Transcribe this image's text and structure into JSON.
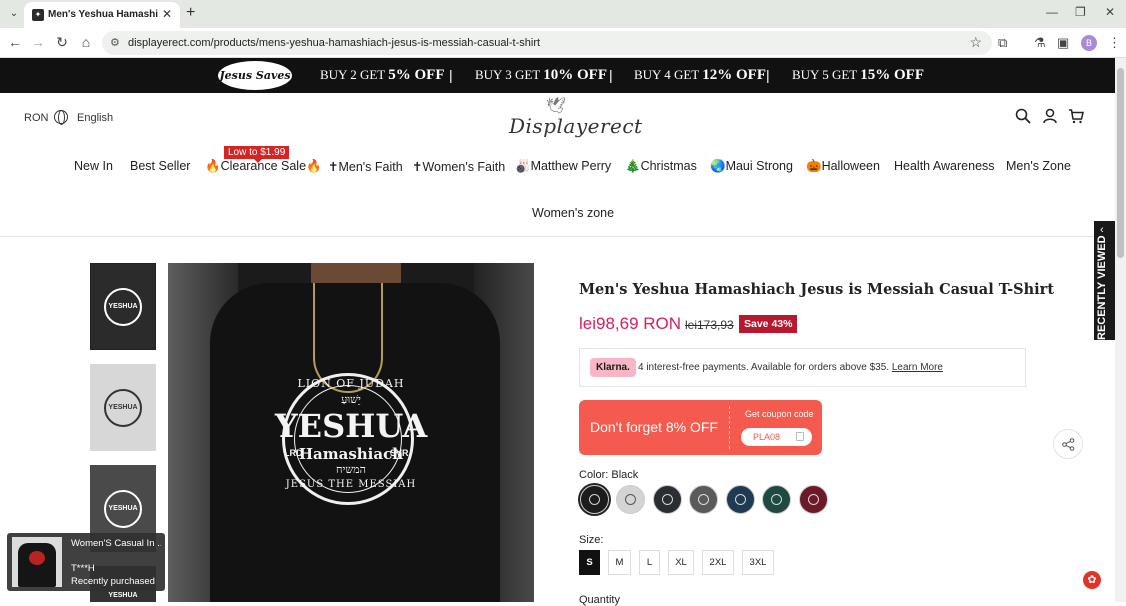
{
  "browser": {
    "tab_title": "Men's Yeshua Hamashiach Jes",
    "url": "displayerect.com/products/mens-yeshua-hamashiach-jesus-is-messiah-casual-t-shirt",
    "profile_initial": "B"
  },
  "promo": {
    "logo_text": "Jesus Saves",
    "offers": [
      {
        "buy": "BUY 2",
        "get": "GET",
        "off": "5% OFF"
      },
      {
        "buy": "BUY 3",
        "get": "GET",
        "off": "10% OFF"
      },
      {
        "buy": "BUY 4",
        "get": "GET",
        "off": "12% OFF"
      },
      {
        "buy": "BUY 5",
        "get": "GET",
        "off": "15% OFF"
      }
    ]
  },
  "header": {
    "currency": "RON",
    "language": "English",
    "logo": "Displayerect"
  },
  "nav": {
    "badge": "Low to $1.99",
    "items": [
      "New In",
      "Best Seller",
      "🔥Clearance Sale🔥",
      "✝Men's Faith",
      "✝Women's Faith",
      "🎳Matthew Perry",
      "🎄Christmas",
      "🌏Maui Strong",
      "🎃Halloween",
      "Health Awareness",
      "Men's Zone",
      "Women's zone"
    ]
  },
  "sidebar": {
    "recently_viewed": "RECENTLY VIEWED"
  },
  "gallery": {
    "thumbnails": [
      "YESHUA",
      "YESHUA",
      "YESHUA",
      "YESHUA"
    ],
    "main_text": {
      "top": "LION OF JUDAH",
      "hebrew_top": "יֵשׁוּעַ",
      "big": "YESHUA",
      "middle": "Hamashiach",
      "left": "LRD",
      "right": "SVR",
      "hebrew_bottom": "המשיח",
      "bottom": "JESUS THE MESSIAH"
    }
  },
  "product": {
    "title": "Men's Yeshua Hamashiach Jesus is Messiah Casual T-Shirt",
    "price": "lei98,69 RON",
    "old_price": "lei173,93",
    "save": "Save 43%",
    "klarna": {
      "logo": "Klarna.",
      "text": "4 interest-free payments. Available for orders above $35.",
      "link": "Learn More"
    },
    "coupon": {
      "main": "Don't forget 8% OFF",
      "get": "Get coupon code",
      "code": "PLA08"
    },
    "color_label": "Color: Black",
    "colors": [
      "#1c1c1c",
      "#d4d4d4",
      "#2a2e33",
      "#5a5a5a",
      "#1f3b52",
      "#1f4a44",
      "#6b1a2a"
    ],
    "size_label": "Size:",
    "sizes": [
      "S",
      "M",
      "L",
      "XL",
      "2XL",
      "3XL"
    ],
    "quantity_label": "Quantity"
  },
  "recent_purchase": {
    "name": "Women'S Casual In ...",
    "user": "T***H",
    "status": "Recently purchased"
  }
}
